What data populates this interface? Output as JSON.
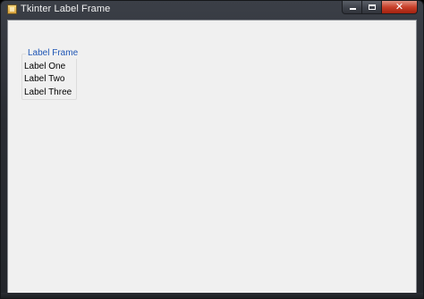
{
  "window": {
    "title": "Tkinter Label Frame",
    "icon": "tk-feather-icon"
  },
  "title_controls": {
    "minimize_icon": "minimize-icon",
    "maximize_icon": "maximize-icon",
    "close_glyph": "✕"
  },
  "label_frame": {
    "title": "Label Frame",
    "labels": [
      "Label One",
      "Label Two",
      "Label Three"
    ]
  },
  "colors": {
    "frame_title": "#1f56b5",
    "client_background": "#f0f0f0",
    "close_button": "#c8402a"
  }
}
